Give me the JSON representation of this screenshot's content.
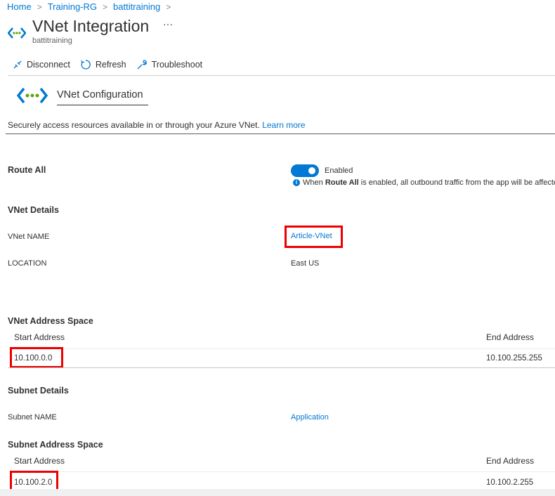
{
  "breadcrumb": [
    "Home",
    "Training-RG",
    "battitraining"
  ],
  "header": {
    "title": "VNet Integration",
    "subtitle": "battitraining",
    "more": "···"
  },
  "toolbar": {
    "disconnect": "Disconnect",
    "refresh": "Refresh",
    "troubleshoot": "Troubleshoot"
  },
  "section": {
    "title": "VNet Configuration",
    "description": "Securely access resources available in or through your Azure VNet.",
    "learn_more": "Learn more"
  },
  "route_all": {
    "label": "Route All",
    "state": "Enabled",
    "enabled": true,
    "info_prefix": "When",
    "info_bold": "Route All",
    "info_suffix": "is enabled, all outbound traffic from the app will be affecte"
  },
  "vnet_details": {
    "heading": "VNet Details",
    "name_label": "VNet NAME",
    "name_value": "Article-VNet",
    "location_label": "LOCATION",
    "location_value": "East US"
  },
  "vnet_address": {
    "heading": "VNet Address Space",
    "start_header": "Start Address",
    "end_header": "End Address",
    "start": "10.100.0.0",
    "end": "10.100.255.255"
  },
  "subnet_details": {
    "heading": "Subnet Details",
    "name_label": "Subnet NAME",
    "name_value": "Application"
  },
  "subnet_address": {
    "heading": "Subnet Address Space",
    "start_header": "Start Address",
    "end_header": "End Address",
    "start": "10.100.2.0",
    "end": "10.100.2.255"
  }
}
